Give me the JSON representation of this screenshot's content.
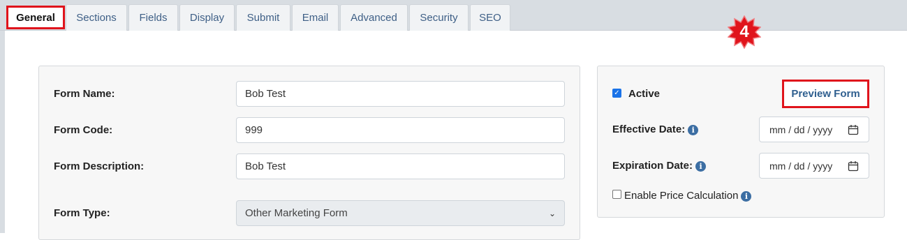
{
  "tabs": [
    {
      "label": "General",
      "active": true
    },
    {
      "label": "Sections"
    },
    {
      "label": "Fields"
    },
    {
      "label": "Display"
    },
    {
      "label": "Submit"
    },
    {
      "label": "Email"
    },
    {
      "label": "Advanced"
    },
    {
      "label": "Security"
    },
    {
      "label": "SEO"
    }
  ],
  "annotation": {
    "step_number": "4",
    "color": "#e0141c"
  },
  "form": {
    "name_label": "Form Name:",
    "name_value": "Bob Test",
    "code_label": "Form Code:",
    "code_value": "999",
    "description_label": "Form Description:",
    "description_value": "Bob Test",
    "type_label": "Form Type:",
    "type_value": "Other Marketing Form"
  },
  "settings": {
    "active_label": "Active",
    "active_checked": true,
    "preview_label": "Preview Form",
    "effective_label": "Effective Date:",
    "effective_placeholder": "mm / dd / yyyy",
    "expiration_label": "Expiration Date:",
    "expiration_placeholder": "mm / dd / yyyy",
    "price_calc_label": "Enable Price Calculation",
    "price_calc_checked": false
  },
  "icons": {
    "info": "info-icon",
    "calendar": "calendar-icon",
    "chevron": "chevron-down-icon",
    "check": "checkmark-icon"
  }
}
